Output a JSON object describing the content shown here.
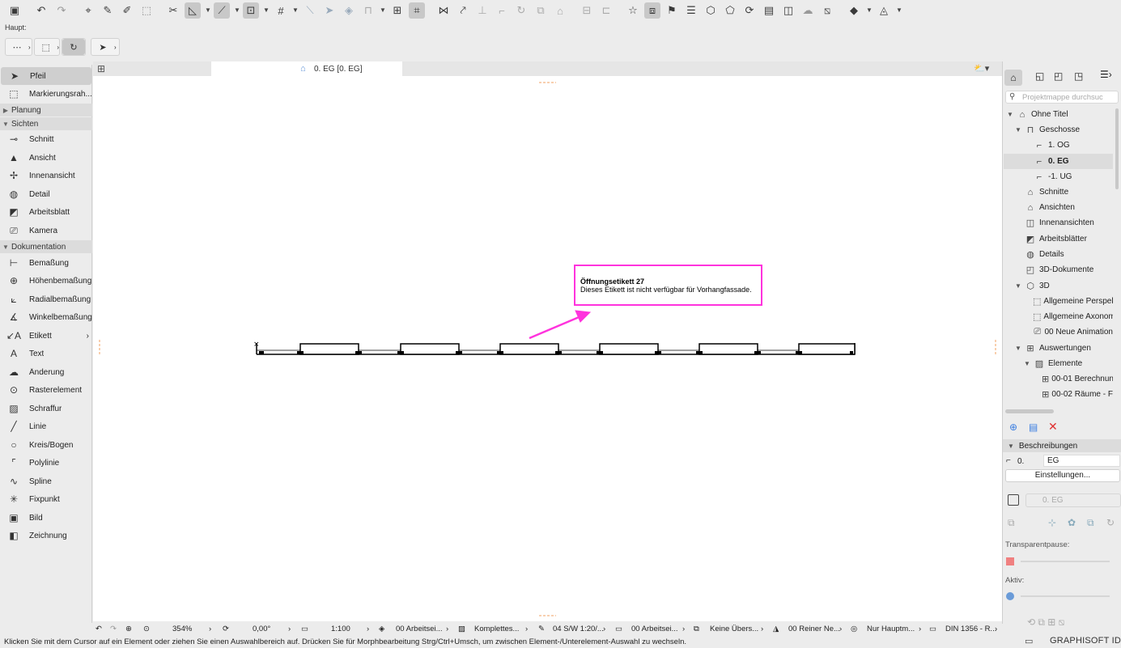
{
  "infobar": {
    "label": "Haupt:"
  },
  "toolbox": {
    "tools_top": [
      {
        "label": "Pfeil",
        "icon": "arrow-icon",
        "selected": true
      },
      {
        "label": "Markierungsrah...",
        "icon": "marquee-icon"
      }
    ],
    "groups": [
      {
        "label": "Planung",
        "expanded": false
      },
      {
        "label": "Sichten",
        "expanded": true
      },
      {
        "label": "Dokumentation",
        "expanded": true
      }
    ],
    "sichten": [
      {
        "label": "Schnitt",
        "icon": "section-icon"
      },
      {
        "label": "Ansicht",
        "icon": "elevation-icon"
      },
      {
        "label": "Innenansicht",
        "icon": "interior-elevation-icon"
      },
      {
        "label": "Detail",
        "icon": "detail-icon"
      },
      {
        "label": "Arbeitsblatt",
        "icon": "worksheet-icon"
      },
      {
        "label": "Kamera",
        "icon": "camera-icon"
      }
    ],
    "dokumentation": [
      {
        "label": "Bemaßung",
        "icon": "dimension-icon"
      },
      {
        "label": "Höhenbemaßung",
        "icon": "level-dimension-icon"
      },
      {
        "label": "Radialbemaßung",
        "icon": "radial-dimension-icon"
      },
      {
        "label": "Winkelbemaßung",
        "icon": "angle-dimension-icon"
      },
      {
        "label": "Etikett",
        "icon": "label-icon",
        "submenu": true
      },
      {
        "label": "Text",
        "icon": "text-icon"
      },
      {
        "label": "Änderung",
        "icon": "change-icon"
      },
      {
        "label": "Rasterelement",
        "icon": "grid-element-icon"
      },
      {
        "label": "Schraffur",
        "icon": "fill-icon"
      },
      {
        "label": "Linie",
        "icon": "line-icon"
      },
      {
        "label": "Kreis/Bogen",
        "icon": "arc-icon"
      },
      {
        "label": "Polylinie",
        "icon": "polyline-icon"
      },
      {
        "label": "Spline",
        "icon": "spline-icon"
      },
      {
        "label": "Fixpunkt",
        "icon": "hotspot-icon"
      },
      {
        "label": "Bild",
        "icon": "image-icon"
      },
      {
        "label": "Zeichnung",
        "icon": "drawing-icon"
      }
    ]
  },
  "tabs": {
    "active_label": "0. EG [0. EG]"
  },
  "canvas": {
    "warning_title": "Öffnungsetikett 27",
    "warning_text": "Dieses Etikett ist nicht verfügbar für Vorhangfassade.",
    "accent": "#ff33dd"
  },
  "navigator": {
    "search_placeholder": "Projektmappe durchsuc",
    "tree": [
      {
        "label": "Ohne Titel",
        "level": 0,
        "icon": "project-icon",
        "expanded": true
      },
      {
        "label": "Geschosse",
        "level": 1,
        "icon": "stories-icon",
        "expanded": true
      },
      {
        "label": "1. OG",
        "level": 2,
        "icon": "story-icon"
      },
      {
        "label": "0. EG",
        "level": 2,
        "icon": "story-icon",
        "selected": true
      },
      {
        "label": "-1. UG",
        "level": 2,
        "icon": "story-icon"
      },
      {
        "label": "Schnitte",
        "level": 1,
        "icon": "sections-icon"
      },
      {
        "label": "Ansichten",
        "level": 1,
        "icon": "elevations-icon"
      },
      {
        "label": "Innenansichten",
        "level": 1,
        "icon": "interior-elevations-icon"
      },
      {
        "label": "Arbeitsblätter",
        "level": 1,
        "icon": "worksheets-icon"
      },
      {
        "label": "Details",
        "level": 1,
        "icon": "details-icon"
      },
      {
        "label": "3D-Dokumente",
        "level": 1,
        "icon": "3d-documents-icon"
      },
      {
        "label": "3D",
        "level": 1,
        "icon": "3d-icon",
        "expanded": true
      },
      {
        "label": "Allgemeine Perspek",
        "level": 2,
        "icon": "perspective-icon"
      },
      {
        "label": "Allgemeine Axonom",
        "level": 2,
        "icon": "axonometry-icon"
      },
      {
        "label": "00 Neue Animation",
        "level": 2,
        "icon": "animation-icon"
      },
      {
        "label": "Auswertungen",
        "level": 1,
        "icon": "schedules-icon",
        "expanded": true
      },
      {
        "label": "Elemente",
        "level": 2,
        "icon": "elements-icon",
        "expanded": true
      },
      {
        "label": "00-01 Berechnun",
        "level": 3,
        "icon": "table-icon"
      },
      {
        "label": "00-02 Räume - F",
        "level": 3,
        "icon": "table-icon"
      }
    ],
    "properties_header": "Beschreibungen",
    "story_number": "0.",
    "story_name": "EG",
    "settings_button": "Einstellungen...",
    "view_story": "0. EG",
    "transparent_label": "Transparentpause:",
    "active_label": "Aktiv:"
  },
  "statusbar": {
    "zoom": "354%",
    "angle": "0,00°",
    "scale": "1:100",
    "layer_combo": "00 Arbeitsei...",
    "construction": "Komplettes...",
    "pen_set": "04 S/W 1:20/...",
    "model_view": "00 Arbeitsei...",
    "override": "Keine Übers...",
    "renovation": "00 Reiner Ne...",
    "structure": "Nur Hauptm...",
    "dimension_std": "DIN 1356 - R..."
  },
  "hint": "Klicken Sie mit dem Cursor auf ein Element oder ziehen Sie einen Auswahlbereich auf. Drücken Sie für Morphbearbeitung Strg/Ctrl+Umsch, um zwischen Element-/Unterelement-Auswahl zu wechseln.",
  "brand": "GRAPHISOFT ID"
}
